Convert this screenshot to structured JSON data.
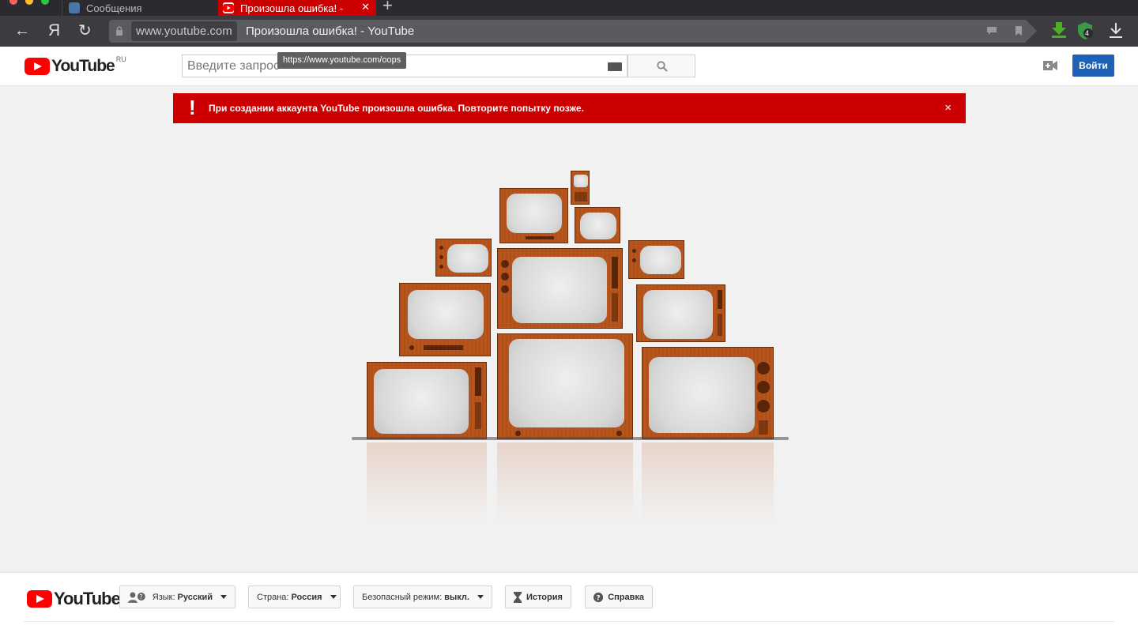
{
  "browser": {
    "tabs": [
      {
        "label": "Сообщения",
        "active": false
      },
      {
        "label": "Произошла ошибка! -",
        "active": true
      }
    ],
    "new_tab": "+",
    "back_glyph": "←",
    "yandex_glyph": "Я",
    "reload_glyph": "↻",
    "address_domain": "www.youtube.com",
    "address_title": "Произошла ошибка! - YouTube",
    "extension_badge": "4",
    "link_tooltip": "https://www.youtube.com/oops"
  },
  "header": {
    "logo_text": "YouTube",
    "region": "RU",
    "search_placeholder": "Введите запрос",
    "login_label": "Войти"
  },
  "alert": {
    "icon": "!",
    "message": "При создании аккаунта YouTube произошла ошибка. Повторите попытку позже.",
    "close": "×"
  },
  "footer": {
    "logo_text": "YouTube",
    "language_label": "Язык:",
    "language_value": "Русский",
    "country_label": "Страна:",
    "country_value": "Россия",
    "safe_label": "Безопасный режим:",
    "safe_value": "выкл.",
    "history_label": "История",
    "help_label": "Справка"
  },
  "colors": {
    "brand_red": "#ff0000",
    "alert_red": "#cc0000",
    "login_blue": "#1c62b9",
    "tv_wood": "#b8551c"
  }
}
